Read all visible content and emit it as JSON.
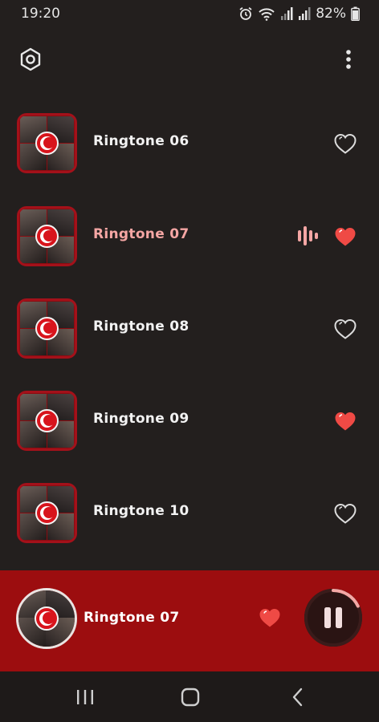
{
  "status_bar": {
    "time": "19:20",
    "battery_text": "82%",
    "icons": [
      "alarm-icon",
      "wifi-icon",
      "signal-icon",
      "signal-icon",
      "battery-icon"
    ]
  },
  "toolbar": {
    "settings_icon": "settings-icon",
    "more_icon": "more-vertical-icon"
  },
  "ringtones": [
    {
      "title": "Ringtone 06",
      "favorite": false,
      "playing": false
    },
    {
      "title": "Ringtone 07",
      "favorite": true,
      "playing": true
    },
    {
      "title": "Ringtone 08",
      "favorite": false,
      "playing": false
    },
    {
      "title": "Ringtone 09",
      "favorite": true,
      "playing": false
    },
    {
      "title": "Ringtone 10",
      "favorite": false,
      "playing": false
    }
  ],
  "player": {
    "title": "Ringtone 07",
    "favorite": true,
    "progress": 0.18,
    "control": "pause-icon"
  },
  "colors": {
    "background": "#231f1e",
    "player_background": "#9c0d0f",
    "accent_heart": "#ef4a45",
    "active_title": "#f5a6a4"
  },
  "nav": [
    "recent-apps-icon",
    "home-icon",
    "back-icon"
  ]
}
